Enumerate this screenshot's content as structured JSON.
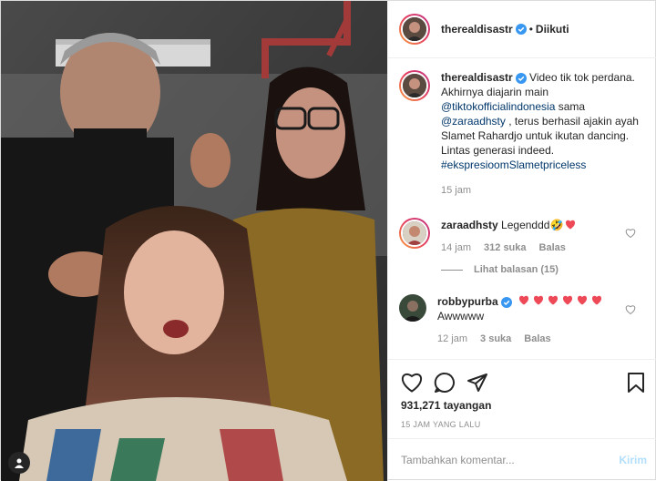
{
  "post": {
    "author": "therealdisastr",
    "follow_status": "Diikuti",
    "separator": "•"
  },
  "caption": {
    "username": "therealdisastr",
    "text_1": " Video tik tok perdana. Akhirnya diajarin main ",
    "mention_1": "@tiktokofficialindonesia",
    "text_2": " sama ",
    "mention_2": "@zaraadhsty",
    "text_3": " , terus berhasil ajakin ayah Slamet Rahardjo untuk ikutan dancing. Lintas generasi indeed. ",
    "hashtag": "#ekspresioomSlametpriceless",
    "time": "15 jam"
  },
  "comments": [
    {
      "username": "zaraadhsty",
      "text": "Legenddd",
      "emoji": "🤣",
      "hearts": 1,
      "time": "14 jam",
      "likes": "312 suka",
      "reply": "Balas",
      "view_replies": "Lihat balasan (15)"
    },
    {
      "username": "robbypurba",
      "text": "Awwwww",
      "hearts": 6,
      "time": "12 jam",
      "likes": "3 suka",
      "reply": "Balas"
    }
  ],
  "stats": {
    "views": "931,271 tayangan",
    "timestamp": "15 JAM YANG LALU"
  },
  "comment_input": {
    "placeholder": "Tambahkan komentar...",
    "post_label": "Kirim"
  },
  "colors": {
    "link": "#00376b",
    "verified": "#3897f0",
    "heart": "#ed4956",
    "post_btn_disabled": "#b2dffc"
  },
  "icons": [
    "heart-icon",
    "comment-icon",
    "share-icon",
    "bookmark-icon",
    "verified-icon",
    "user-tag-icon"
  ]
}
